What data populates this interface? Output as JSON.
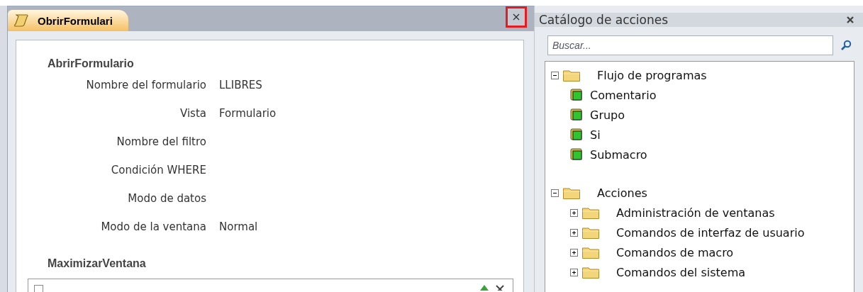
{
  "document_tab": {
    "title": "ObrirFormulari",
    "selected": true,
    "close_highlighted": true
  },
  "macro": {
    "actions": [
      {
        "name": "AbrirFormulario",
        "arguments": [
          {
            "label": "Nombre del formulario",
            "value": "LLIBRES"
          },
          {
            "label": "Vista",
            "value": "Formulario"
          },
          {
            "label": "Nombre del filtro"
          },
          {
            "label": "Condición WHERE"
          },
          {
            "label": "Modo de datos"
          },
          {
            "label": "Modo de la ventana",
            "value": "Normal"
          }
        ]
      },
      {
        "name": "MaximizarVentana"
      }
    ]
  },
  "catalog": {
    "title": "Catálogo de acciones",
    "search": {
      "placeholder": "Buscar..."
    },
    "tree": [
      {
        "label": "Flujo de programas",
        "kind": "folder",
        "expanded": true,
        "children": [
          {
            "label": "Comentario",
            "kind": "action"
          },
          {
            "label": "Grupo",
            "kind": "action"
          },
          {
            "label": "Si",
            "kind": "action"
          },
          {
            "label": "Submacro",
            "kind": "action"
          }
        ]
      },
      {
        "label": "Acciones",
        "kind": "folder",
        "expanded": true,
        "children": [
          {
            "label": "Administración de ventanas",
            "kind": "folder",
            "expanded": false
          },
          {
            "label": "Comandos de interfaz de usuario",
            "kind": "folder",
            "expanded": false
          },
          {
            "label": "Comandos de macro",
            "kind": "folder",
            "expanded": false
          },
          {
            "label": "Comandos del sistema",
            "kind": "folder",
            "expanded": false
          }
        ]
      }
    ]
  }
}
